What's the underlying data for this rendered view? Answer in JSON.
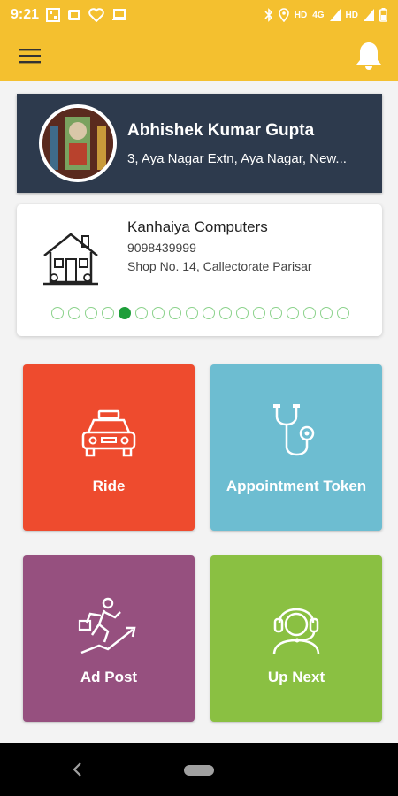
{
  "status_bar": {
    "time": "9:21",
    "network_1": "HD",
    "network_type": "4G",
    "network_2": "HD"
  },
  "app_bar": {
    "menu_icon": "hamburger-menu-icon",
    "notification_icon": "bell-icon",
    "color": "#f4c02f"
  },
  "profile": {
    "name": "Abhishek Kumar Gupta",
    "address": "3, Aya Nagar Extn, Aya Nagar, New...",
    "background": "#2d3a4d"
  },
  "business": {
    "name": "Kanhaiya Computers",
    "phone": "9098439999",
    "address": "Shop No. 14, Callectorate Parisar",
    "icon": "house-icon",
    "carousel_total": 18,
    "carousel_active": 5
  },
  "tiles": [
    {
      "label": "Ride",
      "icon": "taxi-icon",
      "color": "#ee4b2e"
    },
    {
      "label": "Appointment Token",
      "icon": "stethoscope-icon",
      "color": "#6dbdd1"
    },
    {
      "label": "Ad Post",
      "icon": "growth-runner-icon",
      "color": "#96507f"
    },
    {
      "label": "Up Next",
      "icon": "headset-support-icon",
      "color": "#8ac042"
    }
  ],
  "nav_bar": {
    "back_icon": "back-chevron-icon",
    "home_icon": "home-pill-icon"
  }
}
